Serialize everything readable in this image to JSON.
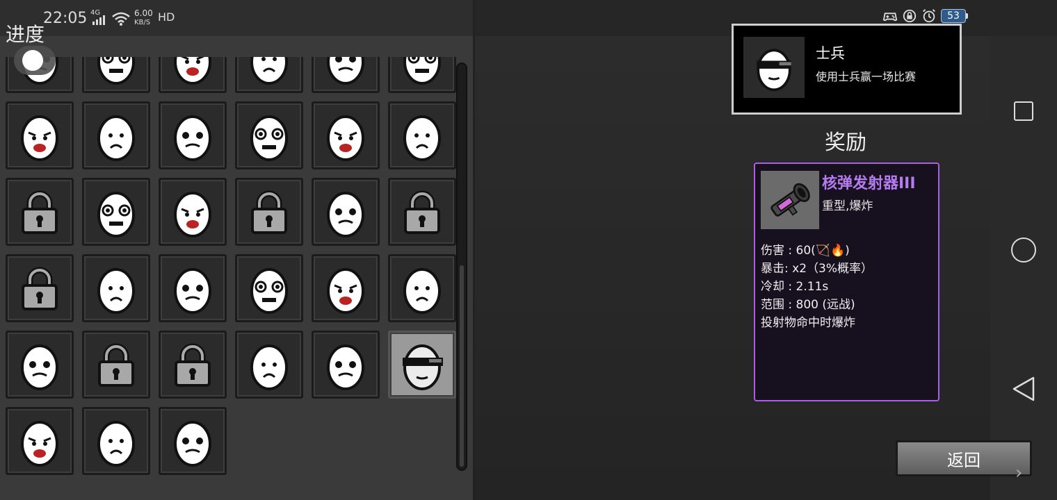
{
  "status_bar": {
    "time": "22:05",
    "network": "4G",
    "speed_value": "6.00",
    "speed_unit": "KB/S",
    "hd": "HD",
    "battery": "53"
  },
  "progress_panel": {
    "title": "进度",
    "rows": [
      [
        "ghost-top",
        "ghost-top",
        "ghost-top",
        "ghost-top",
        "ghost-top",
        "ghost-top"
      ],
      [
        "egg",
        "egg",
        "egg",
        "egg",
        "egg",
        "egg"
      ],
      [
        "lock",
        "egg",
        "egg",
        "lock",
        "egg",
        "lock"
      ],
      [
        "lock",
        "egg",
        "egg",
        "egg",
        "egg",
        "egg"
      ],
      [
        "egg",
        "lock",
        "lock",
        "egg",
        "egg",
        "egg-selected"
      ],
      [
        "egg",
        "egg",
        "egg"
      ]
    ]
  },
  "achievement": {
    "name": "士兵",
    "description": "使用士兵赢一场比赛"
  },
  "reward": {
    "title": "奖励",
    "weapon_name": "核弹发射器III",
    "weapon_type": "重型,爆炸",
    "stats": [
      "伤害 : 60(🏹🔥)",
      "暴击:  x2（3%概率）",
      "冷却 : 2.11s",
      "范围 : 800 (远战)",
      "投射物命中时爆炸"
    ],
    "border_color": "#a760e6",
    "name_color": "#b57cf0"
  },
  "back_button": {
    "label": "返回"
  },
  "icons": {
    "nav_recent": "square-icon",
    "nav_home": "circle-icon",
    "nav_back": "triangle-back-icon"
  }
}
